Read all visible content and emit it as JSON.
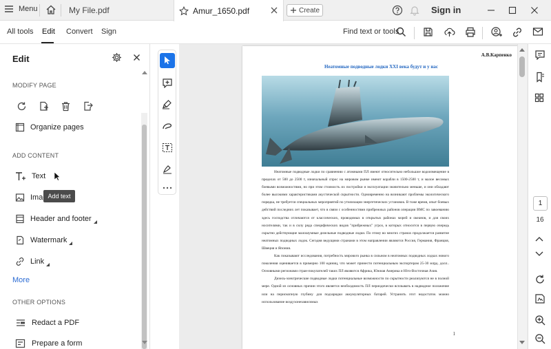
{
  "tabbar": {
    "menu_label": "Menu",
    "tabs": [
      {
        "label": "My File.pdf"
      },
      {
        "label": "Amur_1650.pdf"
      }
    ],
    "create_label": "Create",
    "sign_in": "Sign in"
  },
  "toolbar": {
    "nav": [
      "All tools",
      "Edit",
      "Convert",
      "Sign"
    ],
    "find_label": "Find text or tools"
  },
  "panel": {
    "title": "Edit",
    "modify_heading": "MODIFY PAGE",
    "organize_pages": "Organize pages",
    "add_content_heading": "ADD CONTENT",
    "items": {
      "text": "Text",
      "image": "Image",
      "header_footer": "Header and footer",
      "watermark": "Watermark",
      "link": "Link"
    },
    "more": "More",
    "other_heading": "OTHER OPTIONS",
    "redact": "Redact a PDF",
    "prepare": "Prepare a form",
    "tooltip": "Add text"
  },
  "document": {
    "author": "А.В.Карпенко",
    "title": "Неатомные подводные лодки XXI века будут и  у нас",
    "paragraphs": [
      "Неатомные подводные лодки по сравнению с атомными ПЛ имеют относительно небольшое водоизмещение в пределах от 500 до 2500 т, изначальный спрос на мировом рынке имеют корабли в 1500-2500 т, и малое весомых боевыми возможностями, но при этом стоимость их постройки и эксплуатации значительно меньше, и они обладают более высокими характеристиками акустической скрытности. Одновременно на возникают проблемы экологического порядка, не требуется специальных мероприятий по утилизации энергетических установок. В тоже время, опыт боевых действий последних лет показывает, что в связи с особенностями прибрежных районов операции ВМС по завоеванию здесь господства отличаются от классических, проводимых в открытых районах морей и океанов, и для своих носителями, так и в силу ряда специфических видов \"прибрежных\" угроз, в которых относится в первую очередь скрытно действующие малошумные дизельные подводные лодки. По этому во многих странах продолжается развитие неатомных подводных лодок. Сегодня ведущими странами в этом направлении являются Россия, Германия, Франция, Швеция и Япония.",
      "Как показывают исследования, потребность мирового рынка в сильном в неатомных подводных лодках нового поколения оценивается в примерно 100 единиц, что может принести потенциальным экспортерам 25-30 млрд. долл.. Основными регионами стран-покупателей таких ПЛ являются Африка, Южная Америка и Юго-Восточная Азия.",
      "Дизель-электрические подводные лодки потенциальные возможности по скрытности реализуются не в полной мере. Одной из основных причин этого является необходимость ПЛ периодически всплывать в надводное положение или на перископную глубину для подзарядки аккумуляторных батарей. Устранить этот недостаток можно использование воздухонезависимых"
    ],
    "page_footer": "1"
  },
  "rightrail": {
    "current_page": "1",
    "total_pages": "16"
  }
}
